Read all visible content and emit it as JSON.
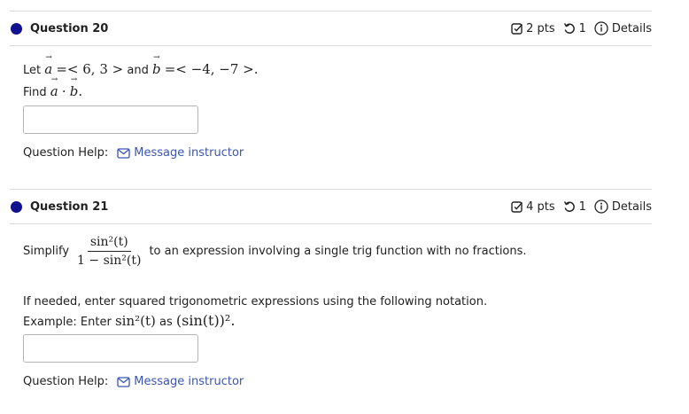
{
  "q20": {
    "title": "Question 20",
    "points": "2 pts",
    "tries": "1",
    "details": "Details",
    "let_text": "Let",
    "a_name": "a",
    "a_value": "=< 6, 3 >",
    "and_text": "and",
    "b_name": "b",
    "b_value": "=< −4, −7 >.",
    "find_text": "Find",
    "find_expr_op": "·",
    "period": ".",
    "help_label": "Question Help:",
    "message_link": "Message instructor"
  },
  "q21": {
    "title": "Question 21",
    "points": "4 pts",
    "tries": "1",
    "details": "Details",
    "simplify_text": "Simplify",
    "numerator": "sin²(t)",
    "denominator": "1 − sin²(t)",
    "after_fraction": "to an expression involving a single trig function with no fractions.",
    "notation_text": "If needed, enter squared trigonometric expressions using the following notation.",
    "example_prefix": "Example: Enter",
    "example_math": "sin²(t)",
    "example_as": "as",
    "example_notation": "(sin(t))².",
    "help_label": "Question Help:",
    "message_link": "Message instructor"
  },
  "icons": {
    "bullet": "filled-circle",
    "points": "checkbox-edit-icon",
    "tries": "retry-icon",
    "details": "info-circle-icon",
    "message": "envelope-icon"
  },
  "colors": {
    "bullet": "#12118f",
    "link": "#3a55b4",
    "border": "#d9d9d9"
  }
}
